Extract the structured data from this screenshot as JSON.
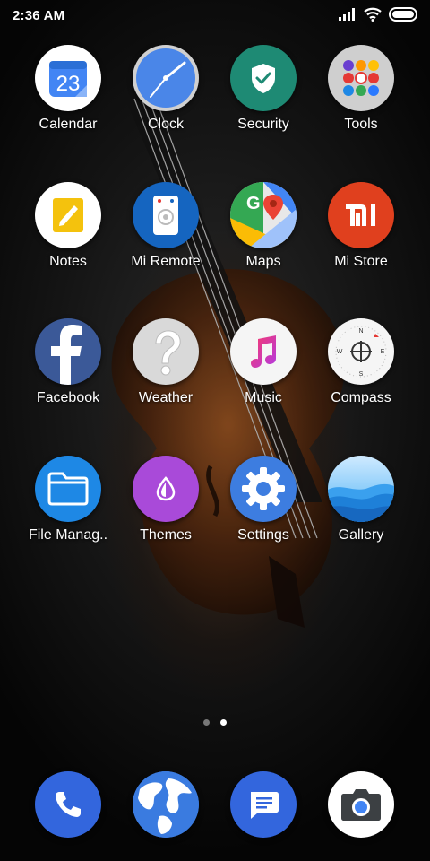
{
  "status_bar": {
    "time": "2:36 AM",
    "icons": [
      "signal-icon",
      "wifi-icon",
      "battery-icon"
    ]
  },
  "apps": [
    {
      "label": "Calendar",
      "icon": "calendar-icon",
      "date": "23"
    },
    {
      "label": "Clock",
      "icon": "clock-icon"
    },
    {
      "label": "Security",
      "icon": "shield-icon"
    },
    {
      "label": "Tools",
      "icon": "folder-icon"
    },
    {
      "label": "Notes",
      "icon": "notes-icon"
    },
    {
      "label": "Mi Remote",
      "icon": "remote-icon"
    },
    {
      "label": "Maps",
      "icon": "maps-icon"
    },
    {
      "label": "Mi Store",
      "icon": "mi-icon"
    },
    {
      "label": "Facebook",
      "icon": "facebook-icon"
    },
    {
      "label": "Weather",
      "icon": "question-icon"
    },
    {
      "label": "Music",
      "icon": "music-icon"
    },
    {
      "label": "Compass",
      "icon": "compass-icon"
    },
    {
      "label": "File Manag..",
      "icon": "folder-icon"
    },
    {
      "label": "Themes",
      "icon": "themes-icon"
    },
    {
      "label": "Settings",
      "icon": "gear-icon"
    },
    {
      "label": "Gallery",
      "icon": "gallery-icon"
    }
  ],
  "page_indicator": {
    "pages": 2,
    "active": 2
  },
  "dock": [
    {
      "icon": "phone-icon"
    },
    {
      "icon": "browser-icon"
    },
    {
      "icon": "messages-icon"
    },
    {
      "icon": "camera-icon"
    }
  ],
  "colors": {
    "calendar": "#4285f4",
    "clock": "#4a86e8",
    "security": "#1e8a74",
    "notes": "#f4c20d",
    "mi_remote": "#1565c0",
    "mi_store": "#e0401e",
    "facebook": "#3b5998",
    "themes": "#a94ad9",
    "settings": "#3d7de0",
    "dock_blue": "#3366dd"
  }
}
